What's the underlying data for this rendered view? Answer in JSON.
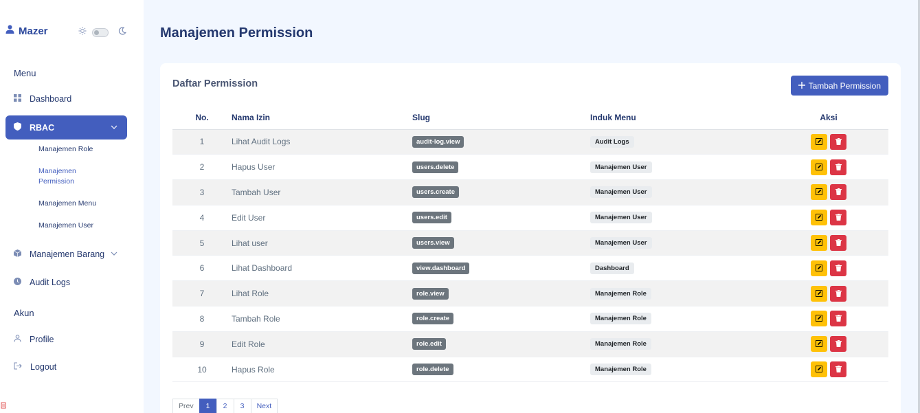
{
  "brand": {
    "name": "Mazer"
  },
  "sidebar": {
    "menu_title": "Menu",
    "items": [
      {
        "label": "Dashboard"
      },
      {
        "label": "RBAC"
      },
      {
        "label": "Manajemen Barang"
      },
      {
        "label": "Audit Logs"
      }
    ],
    "rbac_sub": [
      {
        "label": "Manajemen Role"
      },
      {
        "label": "Manajemen Permission"
      },
      {
        "label": "Manajemen Menu"
      },
      {
        "label": "Manajemen User"
      }
    ],
    "account_title": "Akun",
    "account_items": [
      {
        "label": "Profile"
      },
      {
        "label": "Logout"
      }
    ]
  },
  "page": {
    "title": "Manajemen Permission"
  },
  "card": {
    "title": "Daftar Permission",
    "add_button": "Tambah Permission"
  },
  "table": {
    "headers": {
      "no": "No.",
      "name": "Nama Izin",
      "slug": "Slug",
      "induk": "Induk Menu",
      "aksi": "Aksi"
    },
    "rows": [
      {
        "no": "1",
        "name": "Lihat Audit Logs",
        "slug": "audit-log.view",
        "induk": "Audit Logs"
      },
      {
        "no": "2",
        "name": "Hapus User",
        "slug": "users.delete",
        "induk": "Manajemen User"
      },
      {
        "no": "3",
        "name": "Tambah User",
        "slug": "users.create",
        "induk": "Manajemen User"
      },
      {
        "no": "4",
        "name": "Edit User",
        "slug": "users.edit",
        "induk": "Manajemen User"
      },
      {
        "no": "5",
        "name": "Lihat user",
        "slug": "users.view",
        "induk": "Manajemen User"
      },
      {
        "no": "6",
        "name": "Lihat Dashboard",
        "slug": "view.dashboard",
        "induk": "Dashboard"
      },
      {
        "no": "7",
        "name": "Lihat Role",
        "slug": "role.view",
        "induk": "Manajemen Role"
      },
      {
        "no": "8",
        "name": "Tambah Role",
        "slug": "role.create",
        "induk": "Manajemen Role"
      },
      {
        "no": "9",
        "name": "Edit Role",
        "slug": "role.edit",
        "induk": "Manajemen Role"
      },
      {
        "no": "10",
        "name": "Hapus Role",
        "slug": "role.delete",
        "induk": "Manajemen Role"
      }
    ]
  },
  "pagination": {
    "prev": "Prev",
    "pages": [
      "1",
      "2",
      "3"
    ],
    "next": "Next",
    "current": "1"
  },
  "colors": {
    "primary": "#435ebe",
    "warning": "#ffc107",
    "danger": "#dc3545",
    "slug_badge": "#6c757d",
    "background": "#f2f7ff"
  }
}
